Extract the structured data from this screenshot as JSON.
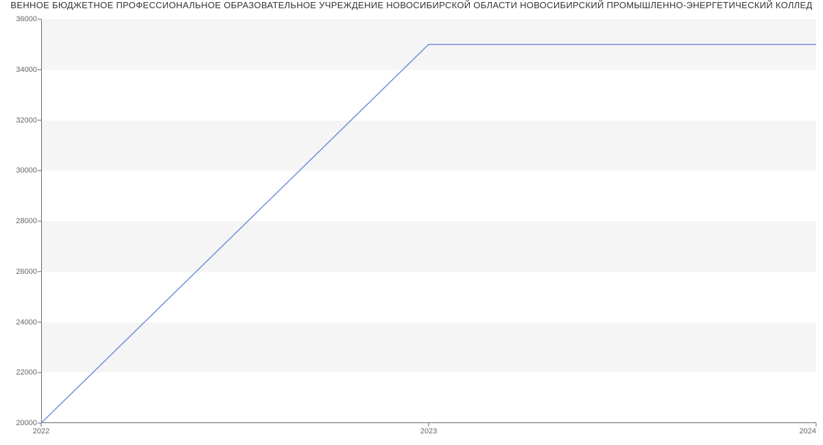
{
  "chart_data": {
    "type": "line",
    "title": "ВЕННОЕ БЮДЖЕТНОЕ ПРОФЕССИОНАЛЬНОЕ ОБРАЗОВАТЕЛЬНОЕ УЧРЕЖДЕНИЕ НОВОСИБИРСКОЙ ОБЛАСТИ НОВОСИБИРСКИЙ ПРОМЫШЛЕННО-ЭНЕРГЕТИЧЕСКИЙ КОЛЛЕД",
    "x": [
      2022,
      2023,
      2024
    ],
    "values": [
      20000,
      35000,
      35000
    ],
    "xlabel": "",
    "ylabel": "",
    "x_ticks": [
      2022,
      2023,
      2024
    ],
    "y_ticks": [
      20000,
      22000,
      24000,
      26000,
      28000,
      30000,
      32000,
      34000,
      36000
    ],
    "xlim": [
      2022,
      2024
    ],
    "ylim": [
      20000,
      36000
    ],
    "line_color": "#6f8fd8",
    "band_color": "#f5f5f5"
  }
}
